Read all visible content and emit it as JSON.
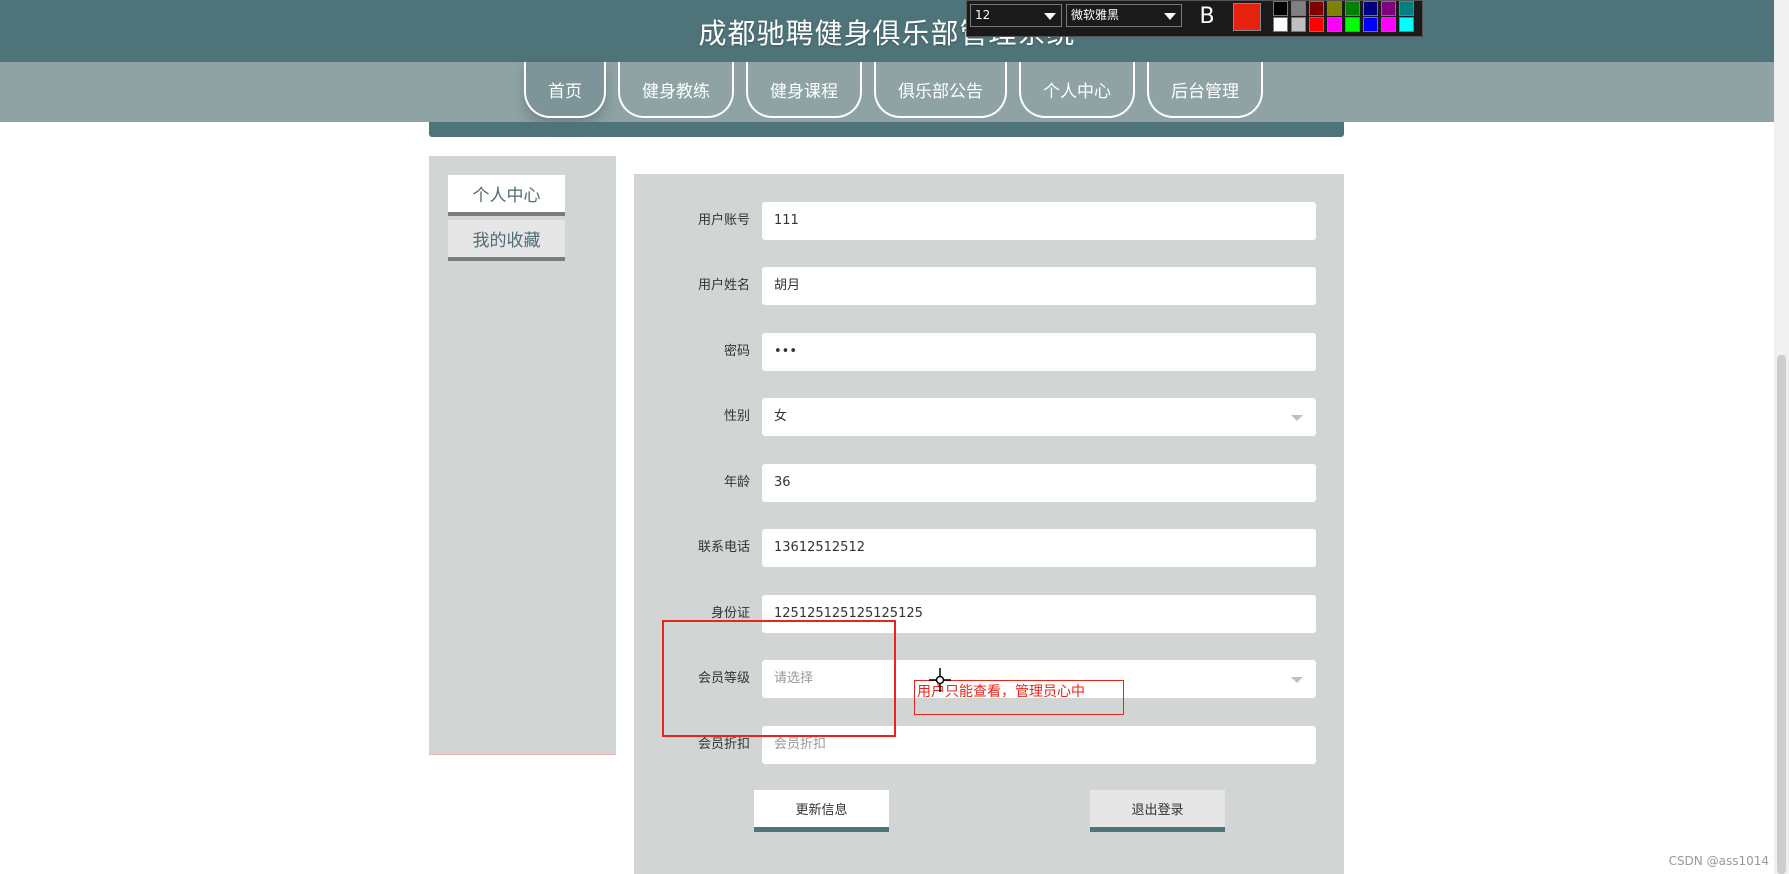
{
  "header": {
    "title": "成都驰聘健身俱乐部管理系统"
  },
  "nav": {
    "items": [
      {
        "label": "首页"
      },
      {
        "label": "健身教练"
      },
      {
        "label": "健身课程"
      },
      {
        "label": "俱乐部公告"
      },
      {
        "label": "个人中心"
      },
      {
        "label": "后台管理"
      }
    ]
  },
  "sidebar": {
    "items": [
      {
        "label": "个人中心"
      },
      {
        "label": "我的收藏"
      }
    ]
  },
  "form": {
    "fields": [
      {
        "label": "用户账号",
        "value": "111"
      },
      {
        "label": "用户姓名",
        "value": "胡月"
      },
      {
        "label": "密码",
        "value": "•••"
      },
      {
        "label": "性别",
        "value": "女"
      },
      {
        "label": "年龄",
        "value": "36"
      },
      {
        "label": "联系电话",
        "value": "13612512512"
      },
      {
        "label": "身份证",
        "value": "125125125125125125"
      },
      {
        "label": "会员等级",
        "placeholder": "请选择"
      },
      {
        "label": "会员折扣",
        "placeholder": "会员折扣"
      }
    ],
    "update_button": "更新信息",
    "logout_button": "退出登录"
  },
  "annotation_toolbar": {
    "font_size": "12",
    "font_name": "微软雅黑",
    "bold_label": "B",
    "current_color": "#e8210f",
    "palette": [
      "#000000",
      "#808080",
      "#800000",
      "#808000",
      "#008000",
      "#000080",
      "#800080",
      "#008080",
      "#ffffff",
      "#c0c0c0",
      "#ff0000",
      "#ff00ff",
      "#00ff00",
      "#0000ff",
      "#ff00ff",
      "#00ffff"
    ]
  },
  "annotation": {
    "text": "用户只能查看，管理员心中",
    "color": "#e8251c"
  },
  "watermark": "CSDN @ass1014"
}
